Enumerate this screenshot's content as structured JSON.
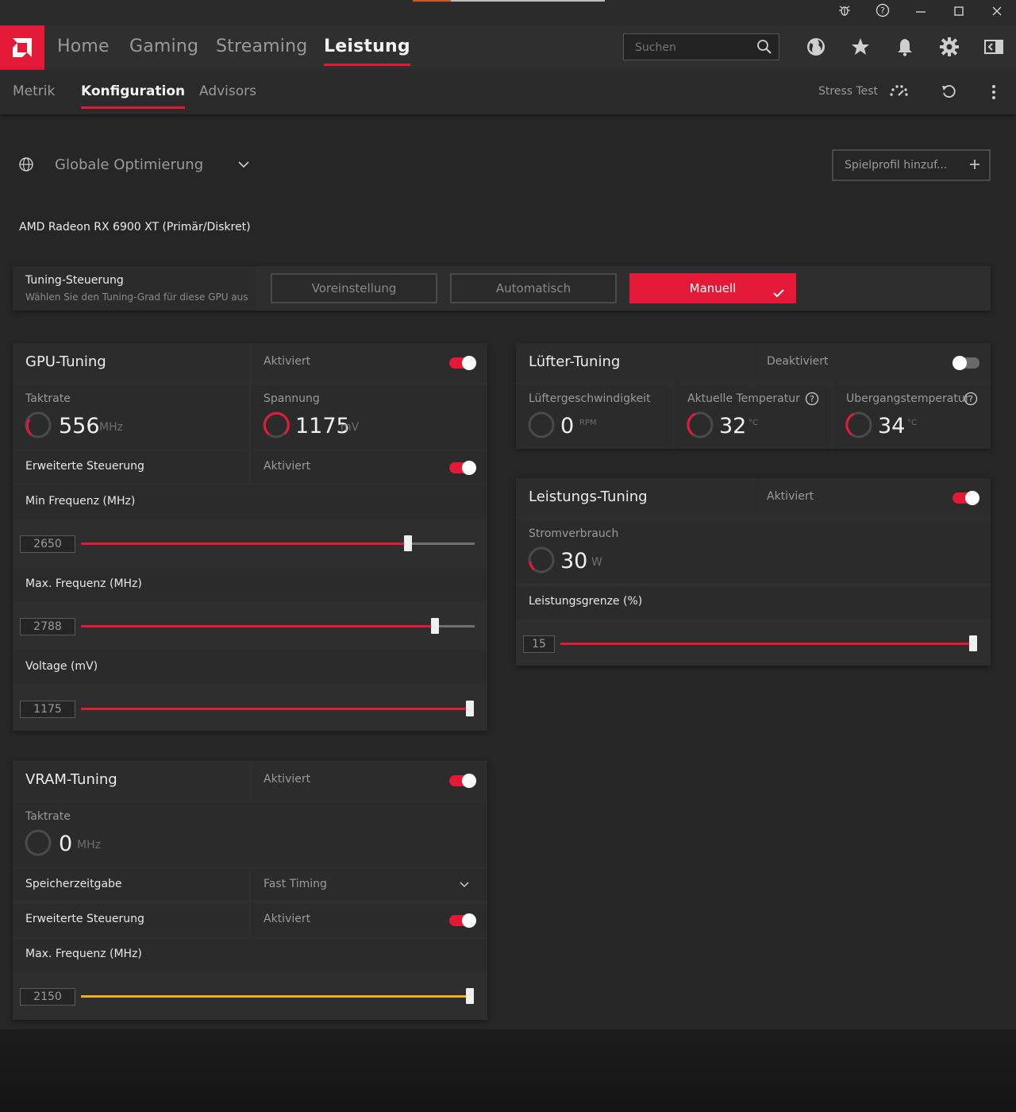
{
  "titlebar": {
    "icons": [
      "bug-icon",
      "help-icon",
      "minimize-icon",
      "maximize-icon",
      "close-icon"
    ]
  },
  "main_nav": {
    "tabs": [
      {
        "label": "Home"
      },
      {
        "label": "Gaming"
      },
      {
        "label": "Streaming"
      },
      {
        "label": "Leistung",
        "active": true
      }
    ],
    "search_placeholder": "Suchen",
    "icons": [
      "globe-icon",
      "star-icon",
      "bell-icon",
      "gear-icon",
      "sidebar-toggle-icon"
    ]
  },
  "sub_nav": {
    "tabs": [
      {
        "label": "Metrik"
      },
      {
        "label": "Konfiguration",
        "active": true
      },
      {
        "label": "Advisors"
      }
    ],
    "stress_test": "Stress Test"
  },
  "profile": {
    "name": "Globale Optimierung",
    "add_profile": "Spielprofil hinzuf..."
  },
  "gpu_name": "AMD Radeon RX 6900 XT (Primär/Diskret)",
  "tuning_control": {
    "title": "Tuning-Steuerung",
    "subtitle": "Wählen Sie den Tuning-Grad für diese GPU aus",
    "options": [
      "Voreinstellung",
      "Automatisch",
      "Manuell"
    ],
    "selected": "Manuell"
  },
  "gpu_tuning": {
    "title": "GPU-Tuning",
    "status": "Aktiviert",
    "enabled": true,
    "clock": {
      "label": "Taktrate",
      "value": "556",
      "unit": "MHz"
    },
    "voltage": {
      "label": "Spannung",
      "value": "1175",
      "unit": "mV"
    },
    "advanced": {
      "label": "Erweiterte Steuerung",
      "status": "Aktiviert",
      "enabled": true
    },
    "min_freq": {
      "label": "Min Frequenz (MHz)",
      "value": "2650",
      "fraction": 0.83
    },
    "max_freq": {
      "label": "Max. Frequenz (MHz)",
      "value": "2788",
      "fraction": 0.9
    },
    "volt_slider": {
      "label": "Voltage (mV)",
      "value": "1175",
      "fraction": 1.0
    }
  },
  "vram_tuning": {
    "title": "VRAM-Tuning",
    "status": "Aktiviert",
    "enabled": true,
    "clock": {
      "label": "Taktrate",
      "value": "0",
      "unit": "MHz"
    },
    "timing": {
      "label": "Speicherzeitgabe",
      "value": "Fast Timing"
    },
    "advanced": {
      "label": "Erweiterte Steuerung",
      "status": "Aktiviert",
      "enabled": true
    },
    "max_freq": {
      "label": "Max. Frequenz (MHz)",
      "value": "2150",
      "fraction": 1.0,
      "color": "#f0b020"
    }
  },
  "fan_tuning": {
    "title": "Lüfter-Tuning",
    "status": "Deaktiviert",
    "enabled": false,
    "speed": {
      "label": "Lüftergeschwindigkeit",
      "value": "0",
      "unit": "RPM"
    },
    "temp": {
      "label": "Aktuelle Temperatur",
      "value": "32",
      "unit": "°C"
    },
    "junction": {
      "label": "Übergangstemperatur",
      "value": "34",
      "unit": "°C"
    }
  },
  "power_tuning": {
    "title": "Leistungs-Tuning",
    "status": "Aktiviert",
    "enabled": true,
    "consumption": {
      "label": "Stromverbrauch",
      "value": "30",
      "unit": "W"
    },
    "limit": {
      "label": "Leistungsgrenze (%)",
      "value": "15",
      "fraction": 1.0
    }
  },
  "colors": {
    "accent": "#e31937",
    "background": "#262626",
    "vram_slider": "#f0b020"
  }
}
